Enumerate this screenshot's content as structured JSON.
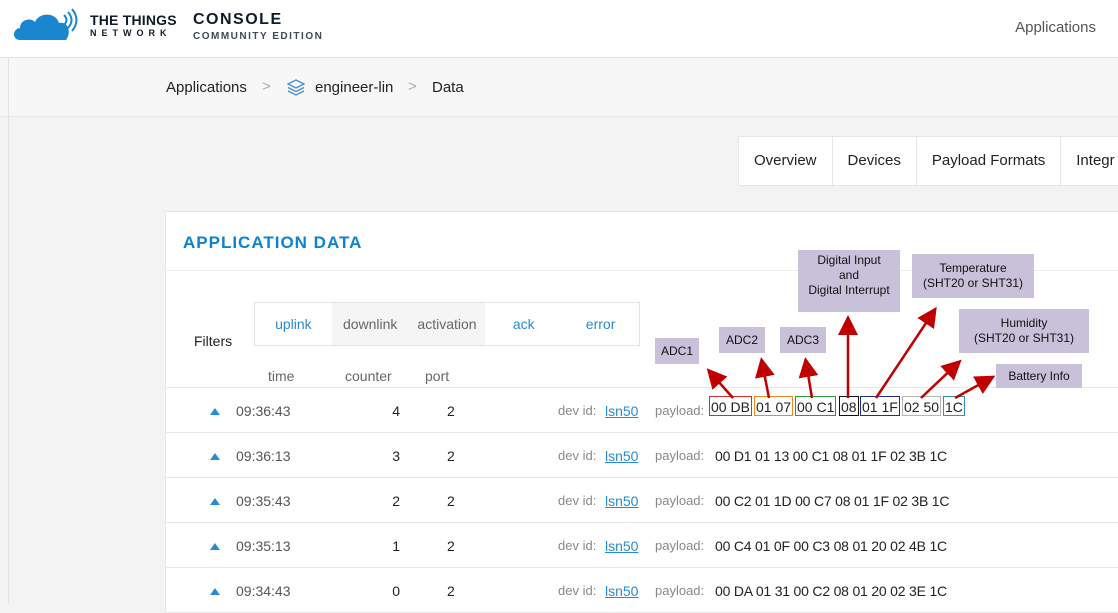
{
  "header": {
    "brand_ttn": "THE THINGS",
    "brand_network": "NETWORK",
    "brand_console": "CONSOLE",
    "brand_edition": "COMMUNITY EDITION",
    "nav_applications": "Applications"
  },
  "breadcrumb": {
    "items": [
      "Applications",
      "engineer-lin",
      "Data"
    ],
    "separator": ">"
  },
  "tabs": [
    "Overview",
    "Devices",
    "Payload Formats",
    "Integr"
  ],
  "card": {
    "title": "APPLICATION DATA",
    "filters_label": "Filters",
    "filters": [
      "uplink",
      "downlink",
      "activation",
      "ack",
      "error"
    ],
    "columns": {
      "time": "time",
      "counter": "counter",
      "port": "port"
    },
    "dev_id_label": "dev id:",
    "payload_label": "payload:"
  },
  "rows": [
    {
      "time": "09:36:43",
      "counter": "4",
      "port": "2",
      "dev_id": "lsn50",
      "payload": "00 DB 01 07 00 C1 08 01 1F 02 50 1C"
    },
    {
      "time": "09:36:13",
      "counter": "3",
      "port": "2",
      "dev_id": "lsn50",
      "payload": "00 D1 01 13 00 C1 08 01 1F 02 3B 1C"
    },
    {
      "time": "09:35:43",
      "counter": "2",
      "port": "2",
      "dev_id": "lsn50",
      "payload": "00 C2 01 1D 00 C7 08 01 1F 02 3B 1C"
    },
    {
      "time": "09:35:13",
      "counter": "1",
      "port": "2",
      "dev_id": "lsn50",
      "payload": "00 C4 01 0F 00 C3 08 01 20 02 4B 1C"
    },
    {
      "time": "09:34:43",
      "counter": "0",
      "port": "2",
      "dev_id": "lsn50",
      "payload": "00 DA 01 31 00 C2 08 01 20 02 3E 1C"
    }
  ],
  "payload_segments": [
    {
      "text": "00 DB",
      "color": "#d0312d"
    },
    {
      "text": "01 07",
      "color": "#f08a1c"
    },
    {
      "text": "00 C1",
      "color": "#2a9a3a"
    },
    {
      "text": "08",
      "color": "#111111"
    },
    {
      "text": "01 1F",
      "color": "#1f2f8f"
    },
    {
      "text": "02 50",
      "color": "#b5b5b5"
    },
    {
      "text": "1C",
      "color": "#3a8fb0"
    }
  ],
  "annotations": {
    "adc1": "ADC1",
    "adc2": "ADC2",
    "adc3": "ADC3",
    "digital_l1": "Digital Input",
    "digital_l2": "and",
    "digital_l3": "Digital Interrupt",
    "temp_l1": "Temperature",
    "temp_l2": "(SHT20 or SHT31)",
    "hum_l1": "Humidity",
    "hum_l2": "(SHT20 or SHT31)",
    "battery": "Battery Info"
  },
  "colors": {
    "accent": "#0d83d0",
    "link": "#2a8bd1",
    "annotation_bg": "#c9c1da",
    "arrow": "#c00000"
  }
}
